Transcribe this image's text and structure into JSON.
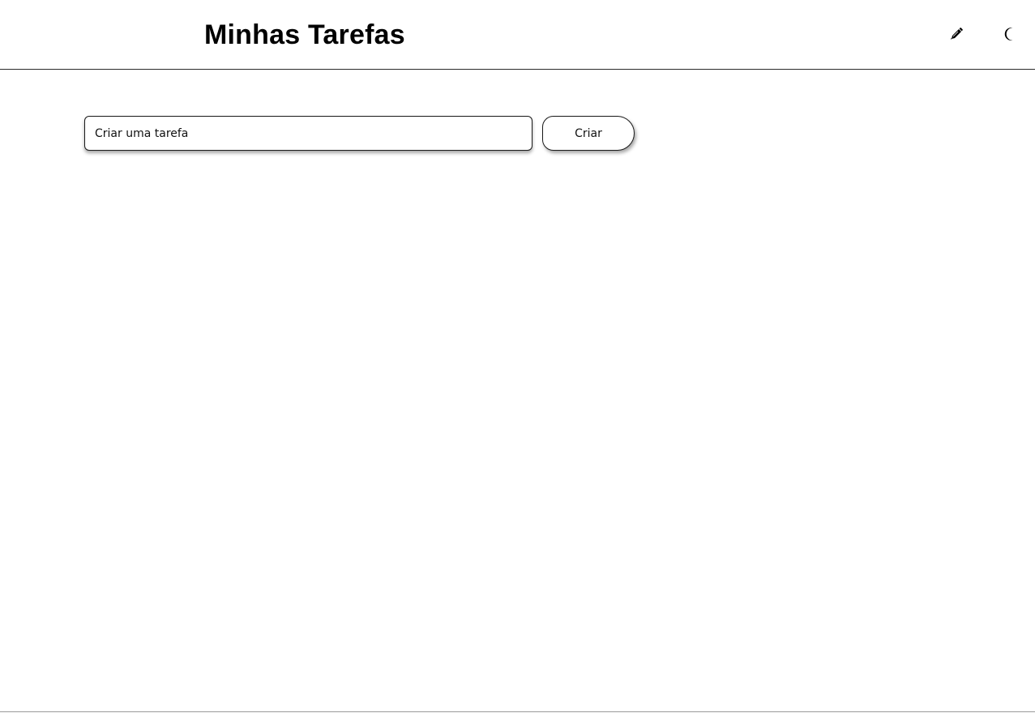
{
  "header": {
    "title": "Minhas Tarefas",
    "edit_icon": "pencil-icon",
    "theme_icon": "moon-icon"
  },
  "task_form": {
    "input_placeholder": "Criar uma tarefa",
    "input_value": "",
    "create_label": "Criar"
  },
  "colors": {
    "text": "#000000",
    "background": "#ffffff",
    "border": "#1a1a1a"
  }
}
